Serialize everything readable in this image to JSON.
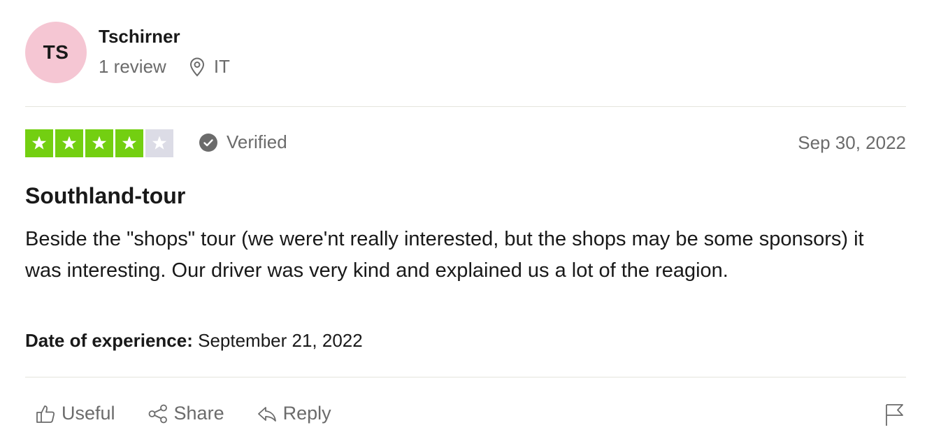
{
  "reviewer": {
    "initials": "TS",
    "name": "Tschirner",
    "review_count": "1 review",
    "location_icon": "location-pin-icon",
    "country": "IT",
    "avatar_color": "#f5c6d3"
  },
  "review": {
    "rating": 4,
    "rating_max": 5,
    "star_color": "#73cf11",
    "empty_star_color": "#dcdce6",
    "verified_label": "Verified",
    "date": "Sep 30, 2022",
    "title": "Southland-tour",
    "body": "Beside the \"shops\" tour (we were'nt really interested, but the shops may be some sponsors) it was interesting. Our driver was very kind and explained us a lot of the reagion.",
    "experience_label": "Date of experience:",
    "experience_date": " September 21, 2022"
  },
  "actions": {
    "useful_label": "Useful",
    "share_label": "Share",
    "reply_label": "Reply",
    "report_icon": "flag-icon"
  }
}
